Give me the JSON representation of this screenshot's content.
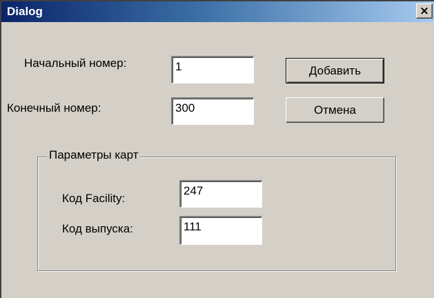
{
  "window": {
    "title": "Dialog",
    "close_glyph": "×"
  },
  "form": {
    "start_label": "Начальный номер:",
    "start_value": "1",
    "end_label": "Конечный номер:",
    "end_value": "300"
  },
  "buttons": {
    "add_label": "Добавить",
    "cancel_label": "Отмена"
  },
  "card_params": {
    "group_title": "Параметры карт",
    "facility_label": "Код Facility:",
    "facility_value": "247",
    "issue_label": "Код выпуска:",
    "issue_value": "111"
  },
  "colors": {
    "titlebar_start": "#0a246a",
    "titlebar_end": "#a6caf0",
    "face": "#d4d0c8"
  }
}
